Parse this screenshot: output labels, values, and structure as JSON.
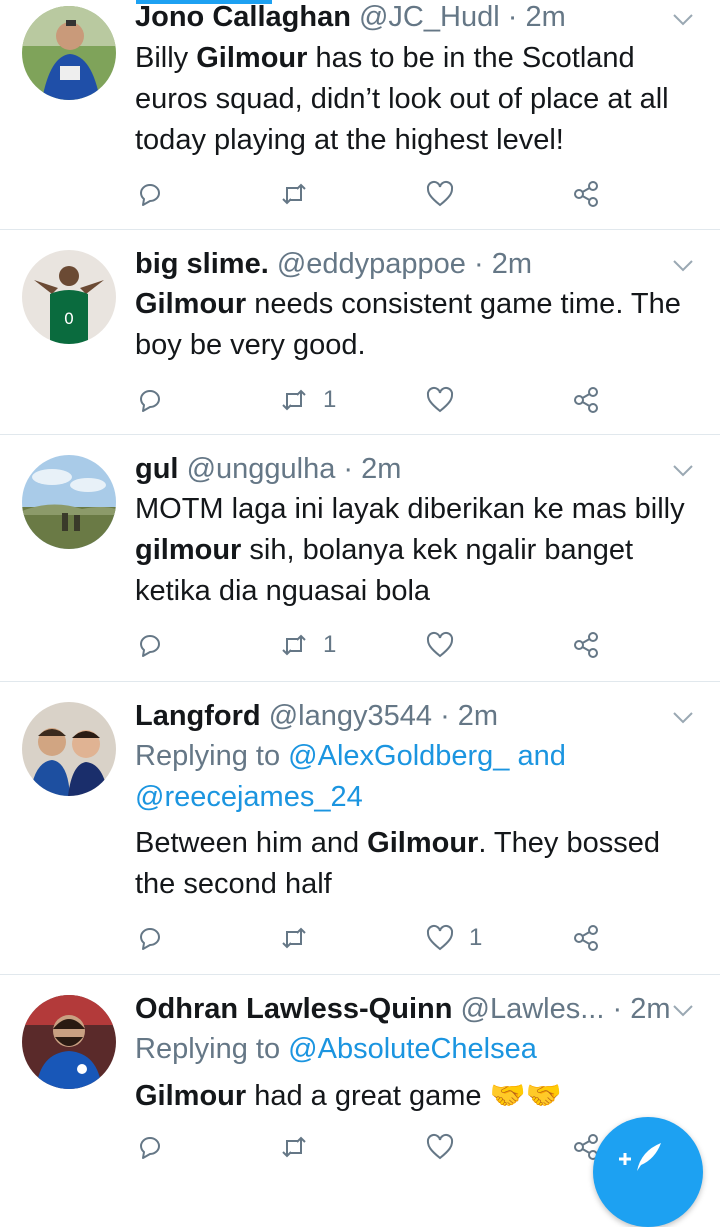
{
  "tweets": [
    {
      "name": "Jono Callaghan",
      "handle": "@JC_Hudl",
      "sep": "·",
      "time": "2m",
      "text": [
        {
          "t": "Billy ",
          "b": false
        },
        {
          "t": "Gilmour",
          "b": true
        },
        {
          "t": " has to be in the Scotland euros squad, didn’t look out of place at all today playing at the highest level!",
          "b": false
        }
      ],
      "counts": {
        "reply": "",
        "retweet": "",
        "like": ""
      }
    },
    {
      "name": "big slime.",
      "handle": "@eddypappoe",
      "sep": "·",
      "time": "2m",
      "text": [
        {
          "t": "Gilmour",
          "b": true
        },
        {
          "t": " needs consistent game time. The boy be very good.",
          "b": false
        }
      ],
      "counts": {
        "reply": "",
        "retweet": "1",
        "like": ""
      }
    },
    {
      "name": "gul",
      "handle": "@unggulha",
      "sep": "·",
      "time": "2m",
      "text": [
        {
          "t": "MOTM laga ini layak diberikan ke mas billy ",
          "b": false
        },
        {
          "t": "gilmour",
          "b": true
        },
        {
          "t": " sih, bolanya kek ngalir banget ketika dia nguasai bola",
          "b": false
        }
      ],
      "counts": {
        "reply": "",
        "retweet": "1",
        "like": ""
      }
    },
    {
      "name": "Langford",
      "handle": "@langy3544",
      "sep": "·",
      "time": "2m",
      "replying_prefix": "Replying to ",
      "replying_mentions": "@AlexGoldberg_ and @reecejames_24",
      "text": [
        {
          "t": "Between him and ",
          "b": false
        },
        {
          "t": "Gilmour",
          "b": true
        },
        {
          "t": ". They bossed the second half",
          "b": false
        }
      ],
      "counts": {
        "reply": "",
        "retweet": "",
        "like": "1"
      }
    },
    {
      "name": "Odhran Lawless-Quinn",
      "handle": "@Lawles...",
      "sep": "·",
      "time": "2m",
      "replying_prefix": "Replying to ",
      "replying_mentions": "@AbsoluteChelsea",
      "text": [
        {
          "t": "Gilmour",
          "b": true
        },
        {
          "t": " had a great game 🤝🤝",
          "b": false
        }
      ],
      "counts": {
        "reply": "",
        "retweet": "",
        "like": ""
      }
    }
  ],
  "icons": {
    "reply": "reply-icon",
    "retweet": "retweet-icon",
    "like": "heart-icon",
    "share": "share-icon",
    "more": "chevron-down-icon",
    "compose": "compose-tweet-icon"
  },
  "colors": {
    "accent": "#1da1f2",
    "mention": "#1b95e0",
    "muted": "#657786",
    "text": "#14171a",
    "divider": "#e1e8ed"
  }
}
